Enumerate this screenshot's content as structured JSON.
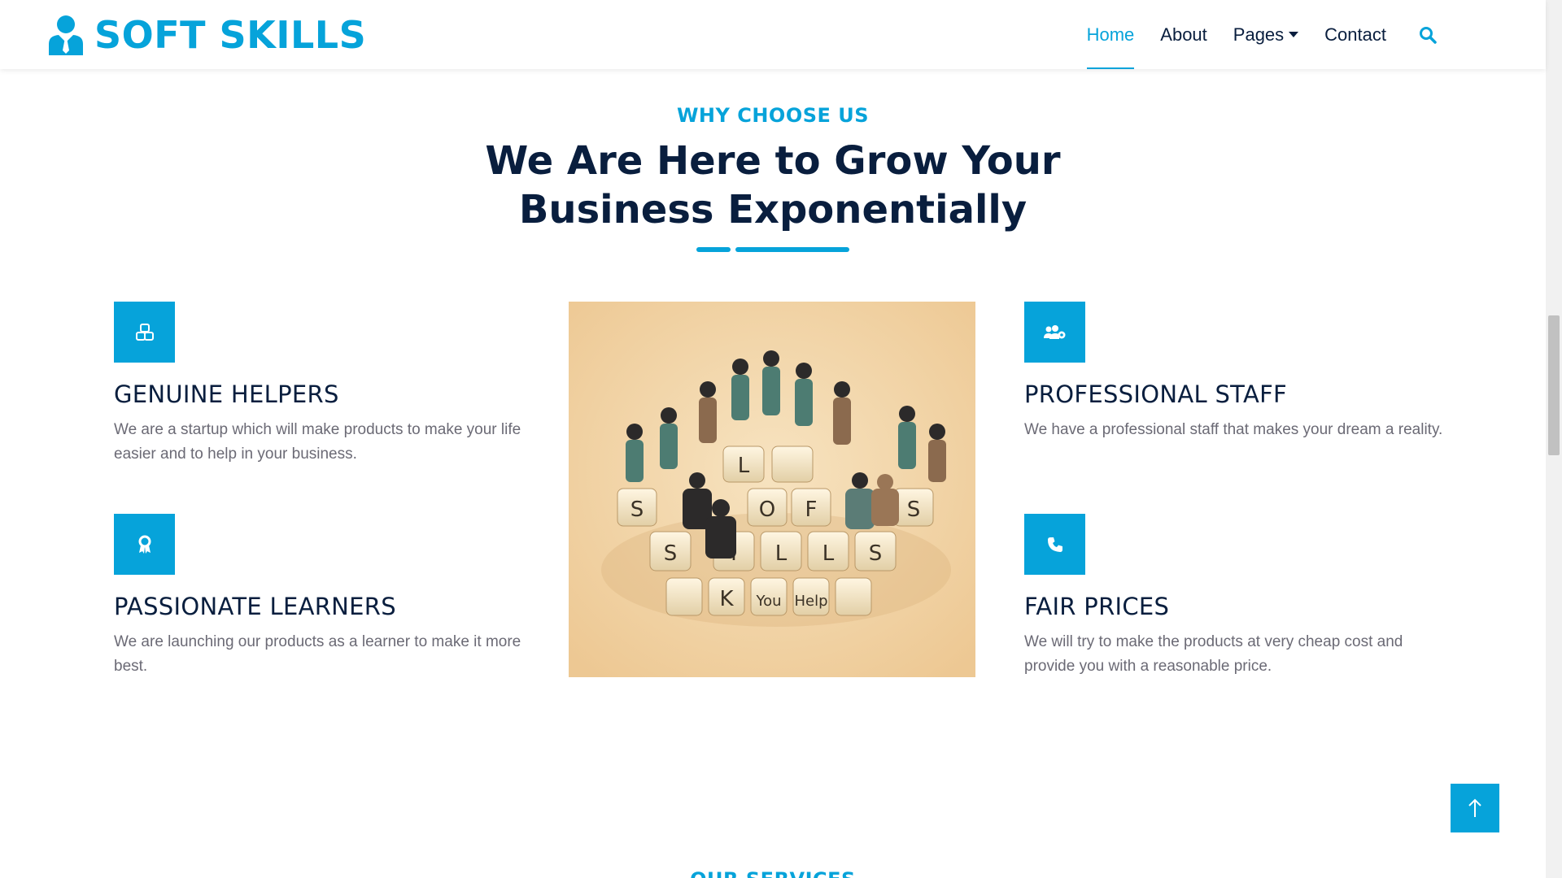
{
  "brand": {
    "name": "SOFT SKILLS",
    "icon": "user-tie-icon"
  },
  "nav": {
    "items": [
      {
        "label": "Home",
        "active": true
      },
      {
        "label": "About",
        "active": false
      },
      {
        "label": "Pages",
        "active": false,
        "dropdown": true
      },
      {
        "label": "Contact",
        "active": false
      }
    ],
    "search_icon": "search-icon"
  },
  "section": {
    "eyebrow": "WHY CHOOSE US",
    "headline_line1": "We Are Here to Grow Your",
    "headline_line2": "Business Exponentially"
  },
  "features": [
    {
      "title": "GENUINE HELPERS",
      "text": "We are a startup which will make products to make your life easier and to help in your business.",
      "icon": "cubes-icon"
    },
    {
      "title": "PASSIONATE LEARNERS",
      "text": "We are launching our products as a learner to make it more best.",
      "icon": "award-icon"
    },
    {
      "title": "PROFESSIONAL STAFF",
      "text": "We have a professional staff that makes your dream a reality.",
      "icon": "users-cog-icon"
    },
    {
      "title": "FAIR PRICES",
      "text": "We will try to make the products at very cheap cost and provide you with a reasonable price.",
      "icon": "phone-icon"
    }
  ],
  "center_image": {
    "alt": "soft-skills-keyboard-figures",
    "keys_row1": [
      "L",
      "K"
    ],
    "keys_row2": [
      "S",
      "O",
      "F",
      "S"
    ],
    "keys_row3": [
      "S",
      "I",
      "L",
      "L",
      "S"
    ],
    "keys_row4": [
      "K",
      "You",
      "Help"
    ]
  },
  "next_section": {
    "eyebrow": "OUR SERVICES"
  },
  "colors": {
    "accent": "#06A3DA",
    "dark": "#091E3E",
    "muted": "#6B6A75"
  }
}
